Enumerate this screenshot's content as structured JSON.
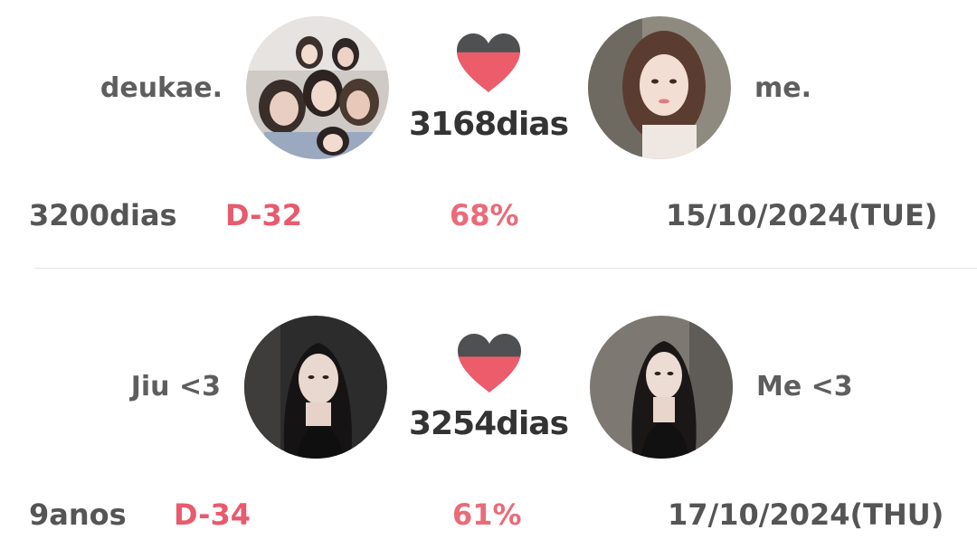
{
  "colors": {
    "text_gray": "#5e5e5e",
    "accent_red": "#e75b6c",
    "heart_fill": "#ec5c6b",
    "heart_empty": "#4f5052",
    "divider": "#e3e3e3"
  },
  "couples": [
    {
      "left_name": "deukae.",
      "right_name": "me.",
      "days_together": "3168dias",
      "heart_fill_fraction": 0.68,
      "stats": {
        "total": "3200dias",
        "countdown": "D-32",
        "percent": "68%",
        "date": "15/10/2024(TUE)"
      }
    },
    {
      "left_name": "Jiu <3",
      "right_name": "Me <3",
      "days_together": "3254dias",
      "heart_fill_fraction": 0.61,
      "stats": {
        "total": "9anos",
        "countdown": "D-34",
        "percent": "61%",
        "date": "17/10/2024(THU)"
      }
    }
  ]
}
